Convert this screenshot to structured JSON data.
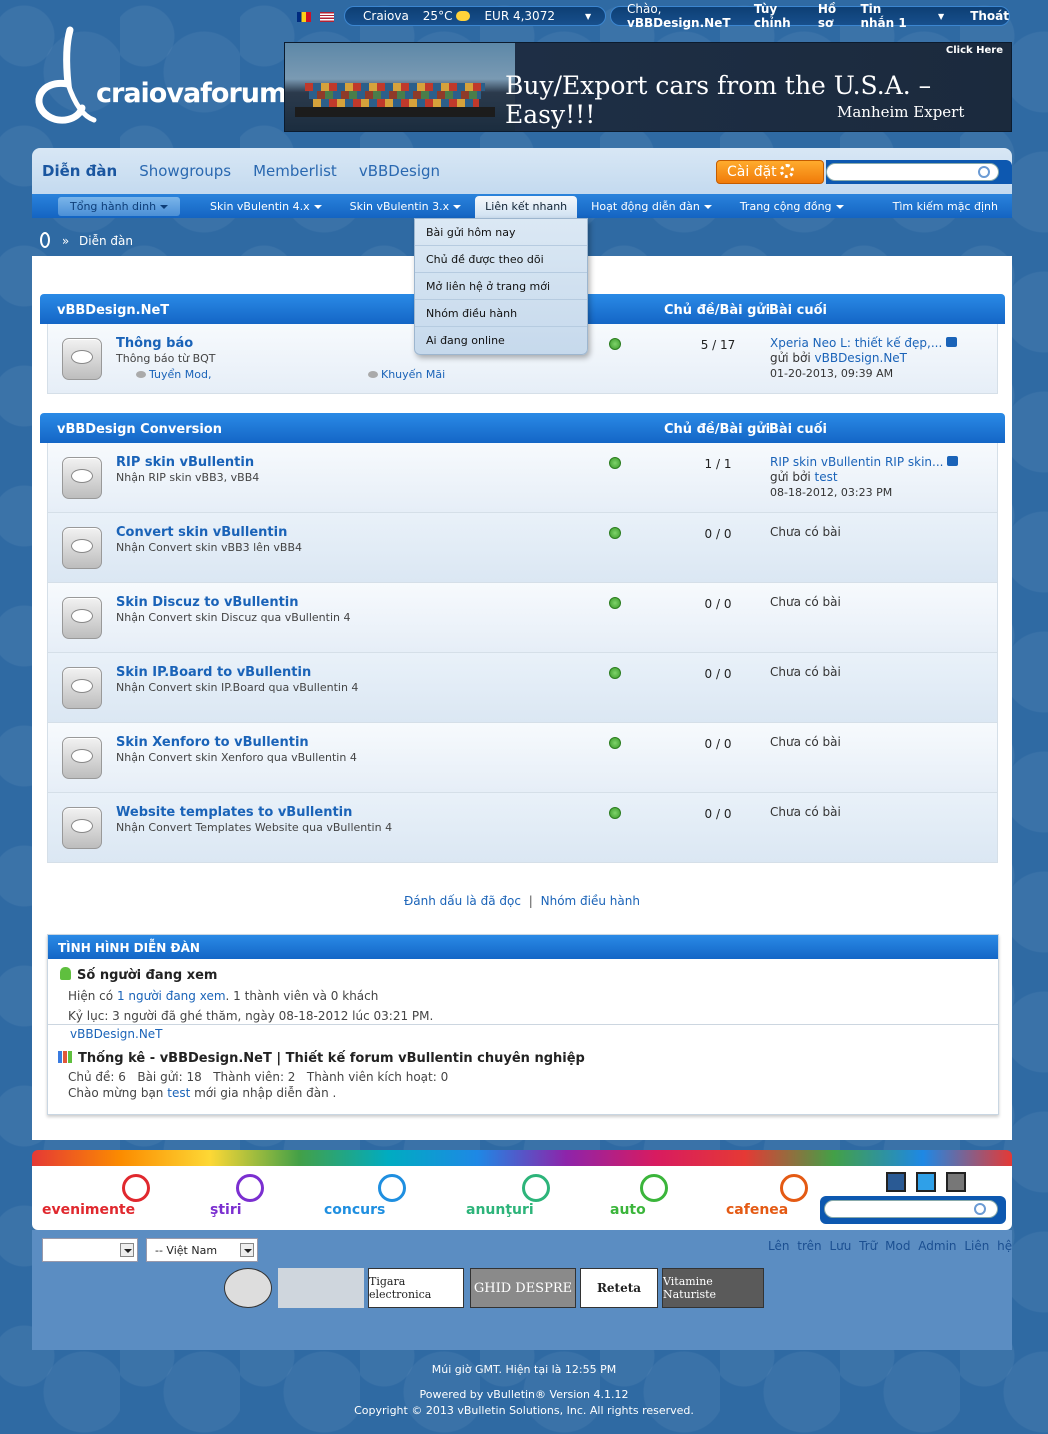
{
  "topbar": {
    "city": "Craiova",
    "temperature": "25°C",
    "currency": "EUR 4,3072",
    "greeting": "Chào,",
    "username": "vBBDesign.NeT",
    "links": [
      "Tùy chỉnh",
      "Hồ sơ",
      "Tin nhắn 1",
      "Thoát"
    ]
  },
  "logo": {
    "text": "craiovaforum"
  },
  "banner": {
    "headline": "Buy/Export cars from the U.S.A. – Easy!!!",
    "brand": "Manheim Expert",
    "click": "Click Here"
  },
  "nav": {
    "tabs": [
      "Diễn đàn",
      "Showgroups",
      "Memberlist",
      "vBBDesign"
    ],
    "settings_label": "Cài đặt",
    "subnav": [
      "Tổng hành dinh",
      "Skin vBulentin 4.x",
      "Skin vBulentin 3.x",
      "Liên kết nhanh",
      "Hoạt động diễn đàn",
      "Trang cộng đồng"
    ],
    "advanced_search": "Tìm kiếm mặc định"
  },
  "dropdown": {
    "items": [
      "Bài gửi hôm nay",
      "Chủ đề được theo dõi",
      "Mở liên hệ ở trang mới",
      "Nhóm điều hành",
      "Ai đang online"
    ]
  },
  "breadcrumb": {
    "sep": "»",
    "current": "Diễn đàn"
  },
  "columns": {
    "threads_posts": "Chủ đề/Bài gửi",
    "last_post": "Bài cuối"
  },
  "categories": [
    {
      "title": "vBBDesign.NeT",
      "forums": [
        {
          "title": "Thông báo",
          "desc": "Thông báo từ BQT",
          "sub1": "Tuyển Mod,",
          "sub2": "Khuyến Mãi",
          "counts": "5 / 17",
          "last_title": "Xperia Neo L: thiết kế đẹp,...",
          "last_by": "gửi bởi",
          "last_user": "vBBDesign.NeT",
          "last_date": "01-20-2013, 09:39 AM"
        }
      ]
    },
    {
      "title": "vBBDesign Conversion",
      "forums": [
        {
          "title": "RIP skin vBullentin",
          "desc": "Nhận RIP skin vBB3, vBB4",
          "counts": "1 / 1",
          "last_title": "RIP skin vBullentin RIP skin...",
          "last_by": "gửi bởi",
          "last_user": "test",
          "last_date": "08-18-2012, 03:23 PM"
        },
        {
          "title": "Convert skin vBullentin",
          "desc": "Nhận Convert skin vBB3 lên vBB4",
          "counts": "0 / 0",
          "no_posts": "Chưa có bài"
        },
        {
          "title": "Skin Discuz to vBullentin",
          "desc": "Nhận Convert skin Discuz qua vBullentin 4",
          "counts": "0 / 0",
          "no_posts": "Chưa có bài"
        },
        {
          "title": "Skin IP.Board to vBullentin",
          "desc": "Nhận Convert skin IP.Board qua vBullentin 4",
          "counts": "0 / 0",
          "no_posts": "Chưa có bài"
        },
        {
          "title": "Skin Xenforo to vBullentin",
          "desc": "Nhận Convert skin Xenforo qua vBullentin 4",
          "counts": "0 / 0",
          "no_posts": "Chưa có bài"
        },
        {
          "title": "Website templates to vBullentin",
          "desc": "Nhận Convert Templates Website qua vBullentin 4",
          "counts": "0 / 0",
          "no_posts": "Chưa có bài"
        }
      ]
    }
  ],
  "links_bottom": {
    "mark_read": "Đánh dấu là đã đọc",
    "sep": "|",
    "moderators": "Nhóm điều hành"
  },
  "stats": {
    "title": "TÌNH HÌNH DIỄN ĐÀN",
    "viewers_title": "Số người đang xem",
    "viewers_pre": "Hiện có",
    "viewers_link": "1 người đang xem",
    "viewers_post": ". 1 thành viên và 0 khách",
    "record": "Kỷ lục: 3 người đã ghé thăm, ngày 08-18-2012 lúc 03:21 PM.",
    "online_user": "vBBDesign.NeT",
    "stats_title": "Thống kê - vBBDesign.NeT | Thiết kế forum vBullentin chuyên nghiệp",
    "stats_line": "Chủ đề: 6   Bài gửi: 18   Thành viên: 2   Thành viên kích hoạt: 0",
    "welcome_pre": "Chào mừng bạn",
    "welcome_user": "test",
    "welcome_post": "mới gia nhập diễn đàn ."
  },
  "portals": [
    {
      "name": "evenimente",
      "color": "#e0282e"
    },
    {
      "name": "ştiri",
      "color": "#7b2fd0"
    },
    {
      "name": "concurs",
      "color": "#1f8fe0"
    },
    {
      "name": "anunţuri",
      "color": "#2db47a"
    },
    {
      "name": "auto",
      "color": "#3bb53b"
    },
    {
      "name": "cafenea",
      "color": "#e45a14"
    }
  ],
  "footer": {
    "select_lang": "-- Việt Nam",
    "links": [
      "Lên trên",
      "Lưu Trữ",
      "Mod",
      "Admin",
      "Liên hệ"
    ],
    "partners": [
      "Tigara electronica",
      "GHID DESPRE",
      "Reteta",
      "Vitamine Naturiste"
    ],
    "timezone": "Múi giờ GMT. Hiện tại là 12:55 PM",
    "powered": "Powered by vBulletin® Version 4.1.12",
    "copyright": "Copyright © 2013 vBulletin Solutions, Inc. All rights reserved."
  }
}
